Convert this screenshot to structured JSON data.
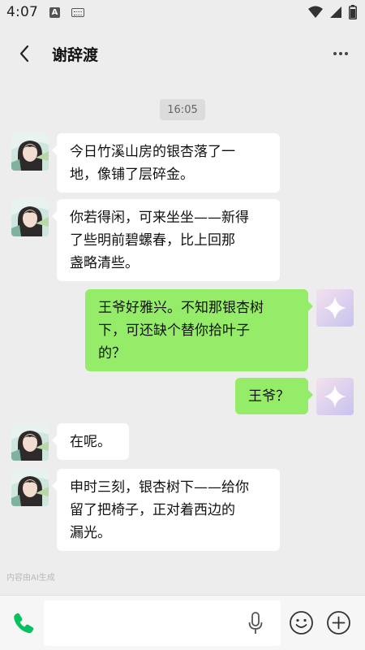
{
  "status_bar": {
    "time": "4:07",
    "a_badge": "A"
  },
  "header": {
    "title": "谢辞渡"
  },
  "chat": {
    "timestamp": "16:05",
    "messages": [
      {
        "side": "in",
        "line1": "今日竹溪山房的银杏落了一",
        "line2": "地，像铺了层碎金。",
        "line3": ""
      },
      {
        "side": "in",
        "line1": "你若得闲，可来坐坐——新得",
        "line2": "了些明前碧螺春，比上回那",
        "line3": "盏略清些。"
      },
      {
        "side": "out",
        "line1": "王爷好雅兴。不知那银杏树",
        "line2": "下，可还缺个替你拾叶子",
        "line3": "的？"
      },
      {
        "side": "out",
        "line1": "王爷？",
        "line2": "",
        "line3": ""
      },
      {
        "side": "in",
        "line1": "在呢。",
        "line2": "",
        "line3": ""
      },
      {
        "side": "in",
        "line1": "申时三刻，银杏树下——给你",
        "line2": "留了把椅子，正对着西边的",
        "line3": "漏光。"
      }
    ],
    "ai_note": "内容由AI生成"
  },
  "input_bar": {
    "value": "",
    "placeholder": ""
  },
  "colors": {
    "background": "#ededed",
    "outgoing_bubble": "#95ec69",
    "incoming_bubble": "#ffffff",
    "phone_icon": "#07c160"
  }
}
